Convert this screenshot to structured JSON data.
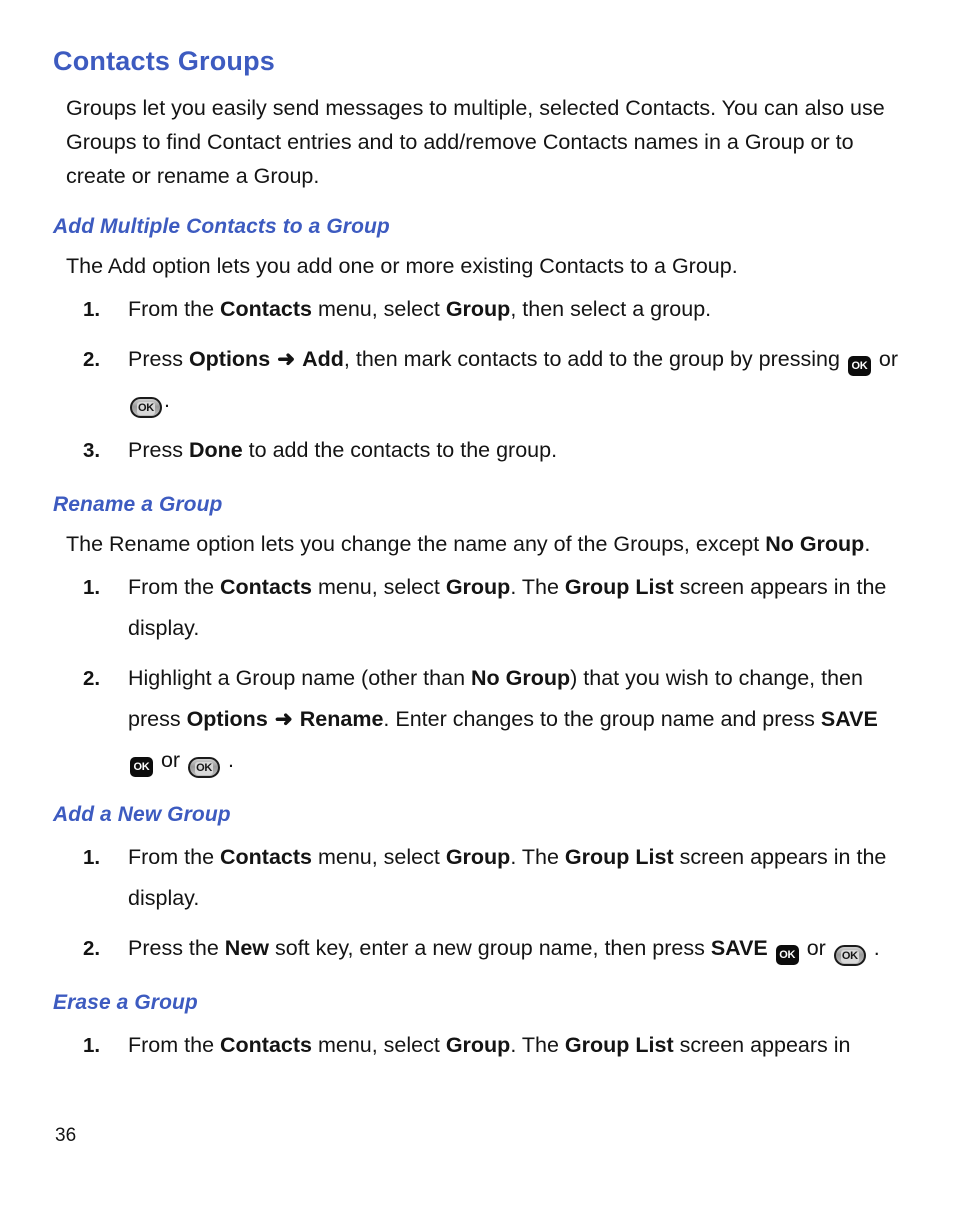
{
  "document": {
    "page_number": "36",
    "heading_color": "#3d5bc0",
    "body_color": "#141414"
  },
  "section": {
    "title": "Contacts Groups",
    "intro": "Groups let you easily send messages to multiple, selected Contacts. You can also use Groups to find Contact entries and to add/remove Contacts names in a Group or to create or rename a Group."
  },
  "subsections": [
    {
      "title": "Add Multiple Contacts to a Group",
      "intro": "The Add option lets you add one or more existing Contacts to a Group.",
      "steps": [
        {
          "number": "1.",
          "parts": [
            {
              "type": "text",
              "value": "From the "
            },
            {
              "type": "bold",
              "value": "Contacts"
            },
            {
              "type": "text",
              "value": " menu, select "
            },
            {
              "type": "bold",
              "value": "Group"
            },
            {
              "type": "text",
              "value": ", then select a group."
            }
          ]
        },
        {
          "number": "2.",
          "parts": [
            {
              "type": "text",
              "value": "Press  "
            },
            {
              "type": "bold",
              "value": "Options"
            },
            {
              "type": "arrow",
              "value": "➜"
            },
            {
              "type": "bold",
              "value": "Add"
            },
            {
              "type": "text",
              "value": ", then mark contacts to add to the group by pressing "
            },
            {
              "type": "key-square",
              "value": "OK"
            },
            {
              "type": "text",
              "value": " or "
            },
            {
              "type": "key-oval",
              "value": "OK"
            },
            {
              "type": "text",
              "value": "."
            }
          ]
        },
        {
          "number": "3.",
          "parts": [
            {
              "type": "text",
              "value": "Press "
            },
            {
              "type": "bold",
              "value": "Done"
            },
            {
              "type": "text",
              "value": " to add the contacts to the group."
            }
          ]
        }
      ]
    },
    {
      "title": "Rename a Group",
      "intro_parts": [
        {
          "type": "text",
          "value": "The Rename option lets you change the name any of the Groups, except "
        },
        {
          "type": "bold",
          "value": "No Group"
        },
        {
          "type": "text",
          "value": "."
        }
      ],
      "steps": [
        {
          "number": "1.",
          "parts": [
            {
              "type": "text",
              "value": "From the "
            },
            {
              "type": "bold",
              "value": "Contacts"
            },
            {
              "type": "text",
              "value": " menu, select "
            },
            {
              "type": "bold",
              "value": "Group"
            },
            {
              "type": "text",
              "value": ". The "
            },
            {
              "type": "bold",
              "value": "Group List"
            },
            {
              "type": "text",
              "value": " screen appears in the display."
            }
          ]
        },
        {
          "number": "2.",
          "parts": [
            {
              "type": "text",
              "value": "Highlight a Group name (other than "
            },
            {
              "type": "bold",
              "value": "No Group"
            },
            {
              "type": "text",
              "value": ") that you wish to change, then press "
            },
            {
              "type": "bold",
              "value": "Options"
            },
            {
              "type": "arrow",
              "value": "➜"
            },
            {
              "type": "bold",
              "value": "Rename"
            },
            {
              "type": "text",
              "value": ".   Enter changes to the group name and press "
            },
            {
              "type": "bold",
              "value": "SAVE"
            },
            {
              "type": "text",
              "value": " "
            },
            {
              "type": "key-square",
              "value": "OK"
            },
            {
              "type": "text",
              "value": " or "
            },
            {
              "type": "key-oval",
              "value": "OK"
            },
            {
              "type": "text",
              "value": " ."
            }
          ]
        }
      ]
    },
    {
      "title": "Add a New Group",
      "steps": [
        {
          "number": "1.",
          "parts": [
            {
              "type": "text",
              "value": "From the "
            },
            {
              "type": "bold",
              "value": "Contacts"
            },
            {
              "type": "text",
              "value": " menu, select "
            },
            {
              "type": "bold",
              "value": "Group"
            },
            {
              "type": "text",
              "value": ". The "
            },
            {
              "type": "bold",
              "value": "Group List"
            },
            {
              "type": "text",
              "value": " screen appears in the display."
            }
          ]
        },
        {
          "number": "2.",
          "parts": [
            {
              "type": "text",
              "value": "Press the "
            },
            {
              "type": "bold",
              "value": "New"
            },
            {
              "type": "text",
              "value": " soft key, enter a new group name, then press "
            },
            {
              "type": "bold",
              "value": "SAVE"
            },
            {
              "type": "text",
              "value": " "
            },
            {
              "type": "key-square",
              "value": "OK"
            },
            {
              "type": "text",
              "value": " or "
            },
            {
              "type": "key-oval",
              "value": "OK"
            },
            {
              "type": "text",
              "value": " ."
            }
          ]
        }
      ]
    },
    {
      "title": "Erase a Group",
      "steps": [
        {
          "number": "1.",
          "parts": [
            {
              "type": "text",
              "value": "From the "
            },
            {
              "type": "bold",
              "value": "Contacts"
            },
            {
              "type": "text",
              "value": " menu, select "
            },
            {
              "type": "bold",
              "value": "Group"
            },
            {
              "type": "text",
              "value": ". The "
            },
            {
              "type": "bold",
              "value": "Group List"
            },
            {
              "type": "text",
              "value": " screen appears in"
            }
          ]
        }
      ]
    }
  ]
}
